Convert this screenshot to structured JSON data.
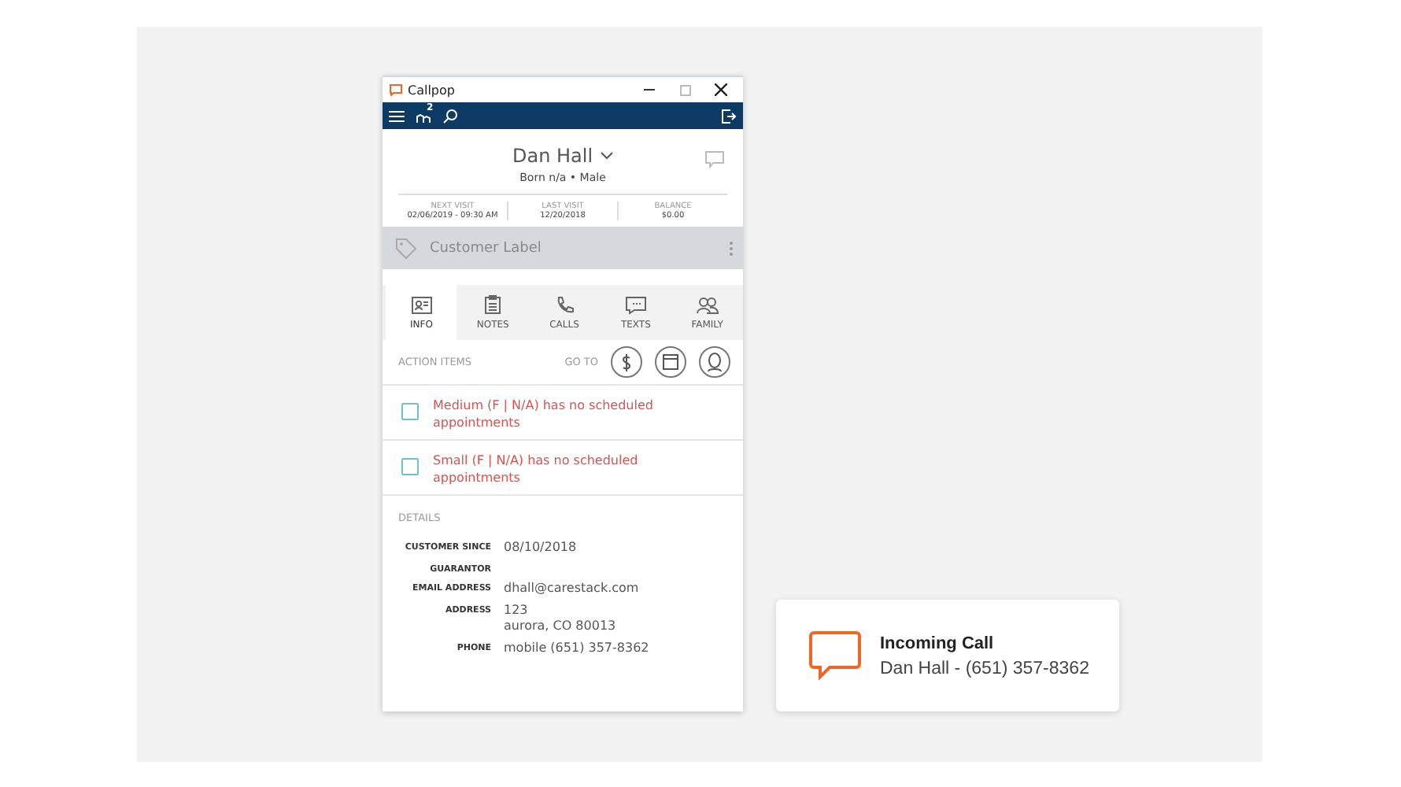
{
  "window": {
    "title": "Callpop"
  },
  "toolbar": {
    "badge": "2"
  },
  "patient": {
    "name": "Dan Hall",
    "subtitle": "Born n/a • Male"
  },
  "stats": [
    {
      "label": "NEXT VISIT",
      "value": "02/06/2019 - 09:30 AM"
    },
    {
      "label": "LAST VISIT",
      "value": "12/20/2018"
    },
    {
      "label": "BALANCE",
      "value": "$0.00"
    }
  ],
  "label_bar": {
    "placeholder": "Customer Label"
  },
  "tabs": [
    {
      "label": "INFO",
      "kind": "info",
      "selected": true
    },
    {
      "label": "NOTES",
      "kind": "notes",
      "selected": false
    },
    {
      "label": "CALLS",
      "kind": "calls",
      "selected": false
    },
    {
      "label": "TEXTS",
      "kind": "texts",
      "selected": false
    },
    {
      "label": "FAMILY",
      "kind": "family",
      "selected": false
    }
  ],
  "action_items": {
    "title": "ACTION ITEMS",
    "goto": "GO TO",
    "items": [
      {
        "text": "Medium (F | N/A) has no scheduled appointments",
        "checked": false
      },
      {
        "text": "Small (F | N/A) has no scheduled appointments",
        "checked": false
      }
    ]
  },
  "details": {
    "title": "DETAILS",
    "fields": [
      {
        "label": "CUSTOMER SINCE",
        "lines": [
          "08/10/2018"
        ]
      },
      {
        "label": "GUARANTOR"
      },
      {
        "label": "EMAIL ADDRESS",
        "lines": [
          "dhall@carestack.com"
        ]
      },
      {
        "label": "ADDRESS",
        "lines": [
          "123",
          "aurora, CO 80013"
        ]
      },
      {
        "label": "PHONE",
        "lines": [
          "mobile (651) 357-8362"
        ]
      }
    ]
  },
  "notification": {
    "title": "Incoming Call",
    "message": "Dan Hall - (651) 357-8362"
  }
}
